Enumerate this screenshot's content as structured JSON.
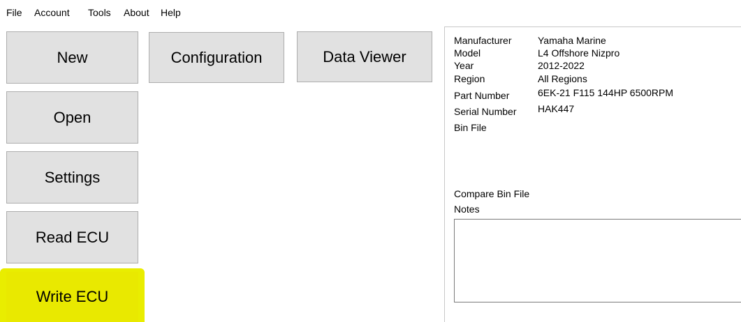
{
  "menu": [
    "File",
    "Account",
    "Tools",
    "About",
    "Help"
  ],
  "buttons": {
    "new": "New",
    "open": "Open",
    "settings": "Settings",
    "read_ecu": "Read ECU",
    "write_ecu": "Write ECU",
    "configuration": "Configuration",
    "data_viewer": "Data Viewer"
  },
  "info": {
    "manufacturer_label": "Manufacturer",
    "manufacturer_value": "Yamaha Marine",
    "model_label": "Model",
    "model_value": "L4 Offshore Nizpro",
    "year_label": "Year",
    "year_value": "2012-2022",
    "region_label": "Region",
    "region_value": "All Regions",
    "part_number_label": "Part Number",
    "part_number_value": "6EK-21 F115 144HP 6500RPM",
    "serial_number_label": "Serial Number",
    "serial_number_value": "HAK447",
    "bin_file_label": "Bin File",
    "compare_bin_file_label": "Compare Bin File",
    "notes_label": "Notes",
    "notes_value": ""
  },
  "colors": {
    "button_bg": "#e1e1e1",
    "highlight": "#e9ed00"
  }
}
